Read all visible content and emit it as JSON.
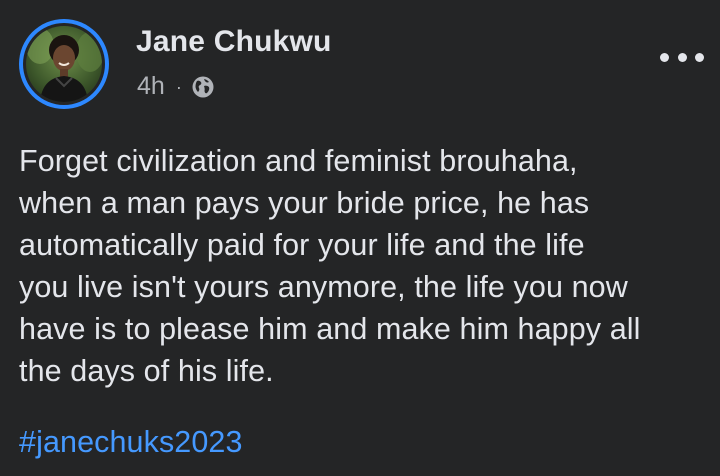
{
  "post": {
    "author_name": "Jane Chukwu",
    "time": "4h",
    "separator": "·",
    "audience_icon": "globe-icon",
    "more_icon": "more-options-icon",
    "text": "Forget civilization and feminist brouhaha,\nwhen a man pays your bride price, he has\nautomatically paid for your life and the life\nyou live isn't yours anymore, the life you now\nhave is to please him and make him happy all\nthe days of his life.",
    "hashtag": "#janechuks2023"
  },
  "colors": {
    "background": "#242526",
    "primary_text": "#e4e6eb",
    "secondary_text": "#b0b3b8",
    "link": "#4599ff",
    "story_ring": "#2d88ff"
  }
}
